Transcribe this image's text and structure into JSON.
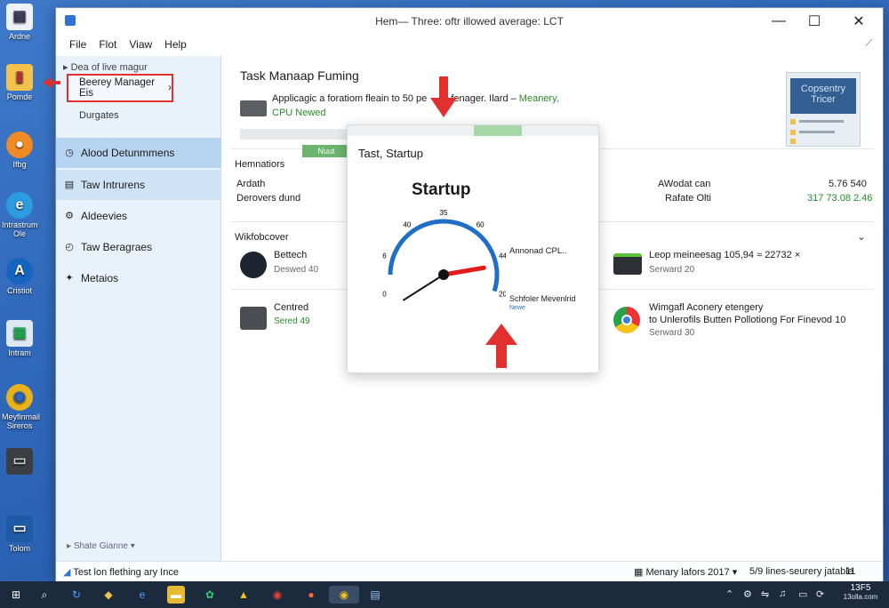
{
  "desktop": {
    "icons": [
      {
        "label": "Ardne"
      },
      {
        "label": "Pomde"
      },
      {
        "label": "Ifbg"
      },
      {
        "label": "Intrastrum Ole"
      },
      {
        "label": "Cristiot"
      },
      {
        "label": "Intram"
      },
      {
        "label": "Meyfinmail Sireros"
      },
      {
        "label": ""
      },
      {
        "label": "Tolom"
      }
    ]
  },
  "window": {
    "title": "Hem— Three: oftr illowed average: LCT",
    "menu": [
      "File",
      "Flot",
      "Viaw",
      "Help"
    ]
  },
  "sidebar": {
    "crumb": "Dea of live magur",
    "highlight": "Beerey Manager Eis",
    "sub": "Durgates",
    "items": [
      {
        "label": "Alood Detunmmens",
        "icon": "clock-icon"
      },
      {
        "label": "Taw Intrurens",
        "icon": "list-icon"
      },
      {
        "label": "Aldeevies",
        "icon": "gear-icon"
      },
      {
        "label": "Taw Beragraes",
        "icon": "clock-icon"
      },
      {
        "label": "Metaios",
        "icon": "pin-icon"
      }
    ],
    "footer": "Shate Gianne"
  },
  "main": {
    "heading": "Task Manaap Fuming",
    "desc_text": "Applicagic a foratiom fleain to 50 pe",
    "desc_tail": "fenager. Ilard –",
    "desc_tail_green": "Meanery,",
    "desc_line2": "CPU Newed",
    "thumb": "Copsentry Tricer",
    "section1": {
      "title": "Hemnatiors",
      "badge": "Nuut",
      "rows": [
        {
          "left": "Ardath",
          "mid": "AWodat can",
          "right": "5.76 540"
        },
        {
          "left": "Derovers dund",
          "mid": "Rafate Olti",
          "right": "317 73.08 2.46"
        }
      ]
    },
    "section2": {
      "title": "Wikfobcover",
      "left_items": [
        {
          "name": "Bettech",
          "sub": "Deswed 40"
        },
        {
          "name": "Centred",
          "sub": "Sered 49"
        }
      ],
      "right_items": [
        {
          "name": "Leop meineesag 105,94 ≈ 22732 ×",
          "sub": "Serward 20"
        },
        {
          "name": "Wimgafl Aconery etengery",
          "name2": "to Unlerofils Butten Pollotiong For Finevod 10",
          "sub": "Serward 30"
        }
      ]
    }
  },
  "popup": {
    "title": "Tast, Startup",
    "big": "Startup",
    "gauge_value": 0.86,
    "ticks": [
      "0",
      "6",
      "40",
      "35",
      "60",
      "44",
      "20"
    ],
    "label1": "Annonad CPL..",
    "label2": "Schfoler Mevenlrid",
    "label3": "Newe"
  },
  "status": {
    "left": "Test lon flething ary Ince",
    "mid": "Menary lafors 2017",
    "right": "5/9 lines-seurery jatable",
    "end": "11"
  },
  "taskbar": {
    "clock": "13F5",
    "date": "13olla.com"
  },
  "colors": {
    "accent": "#2f74d0",
    "gauge": "#1f6fc6",
    "needle": "#e21b1b",
    "green": "#2a8a2a",
    "callout": "#e03030"
  }
}
